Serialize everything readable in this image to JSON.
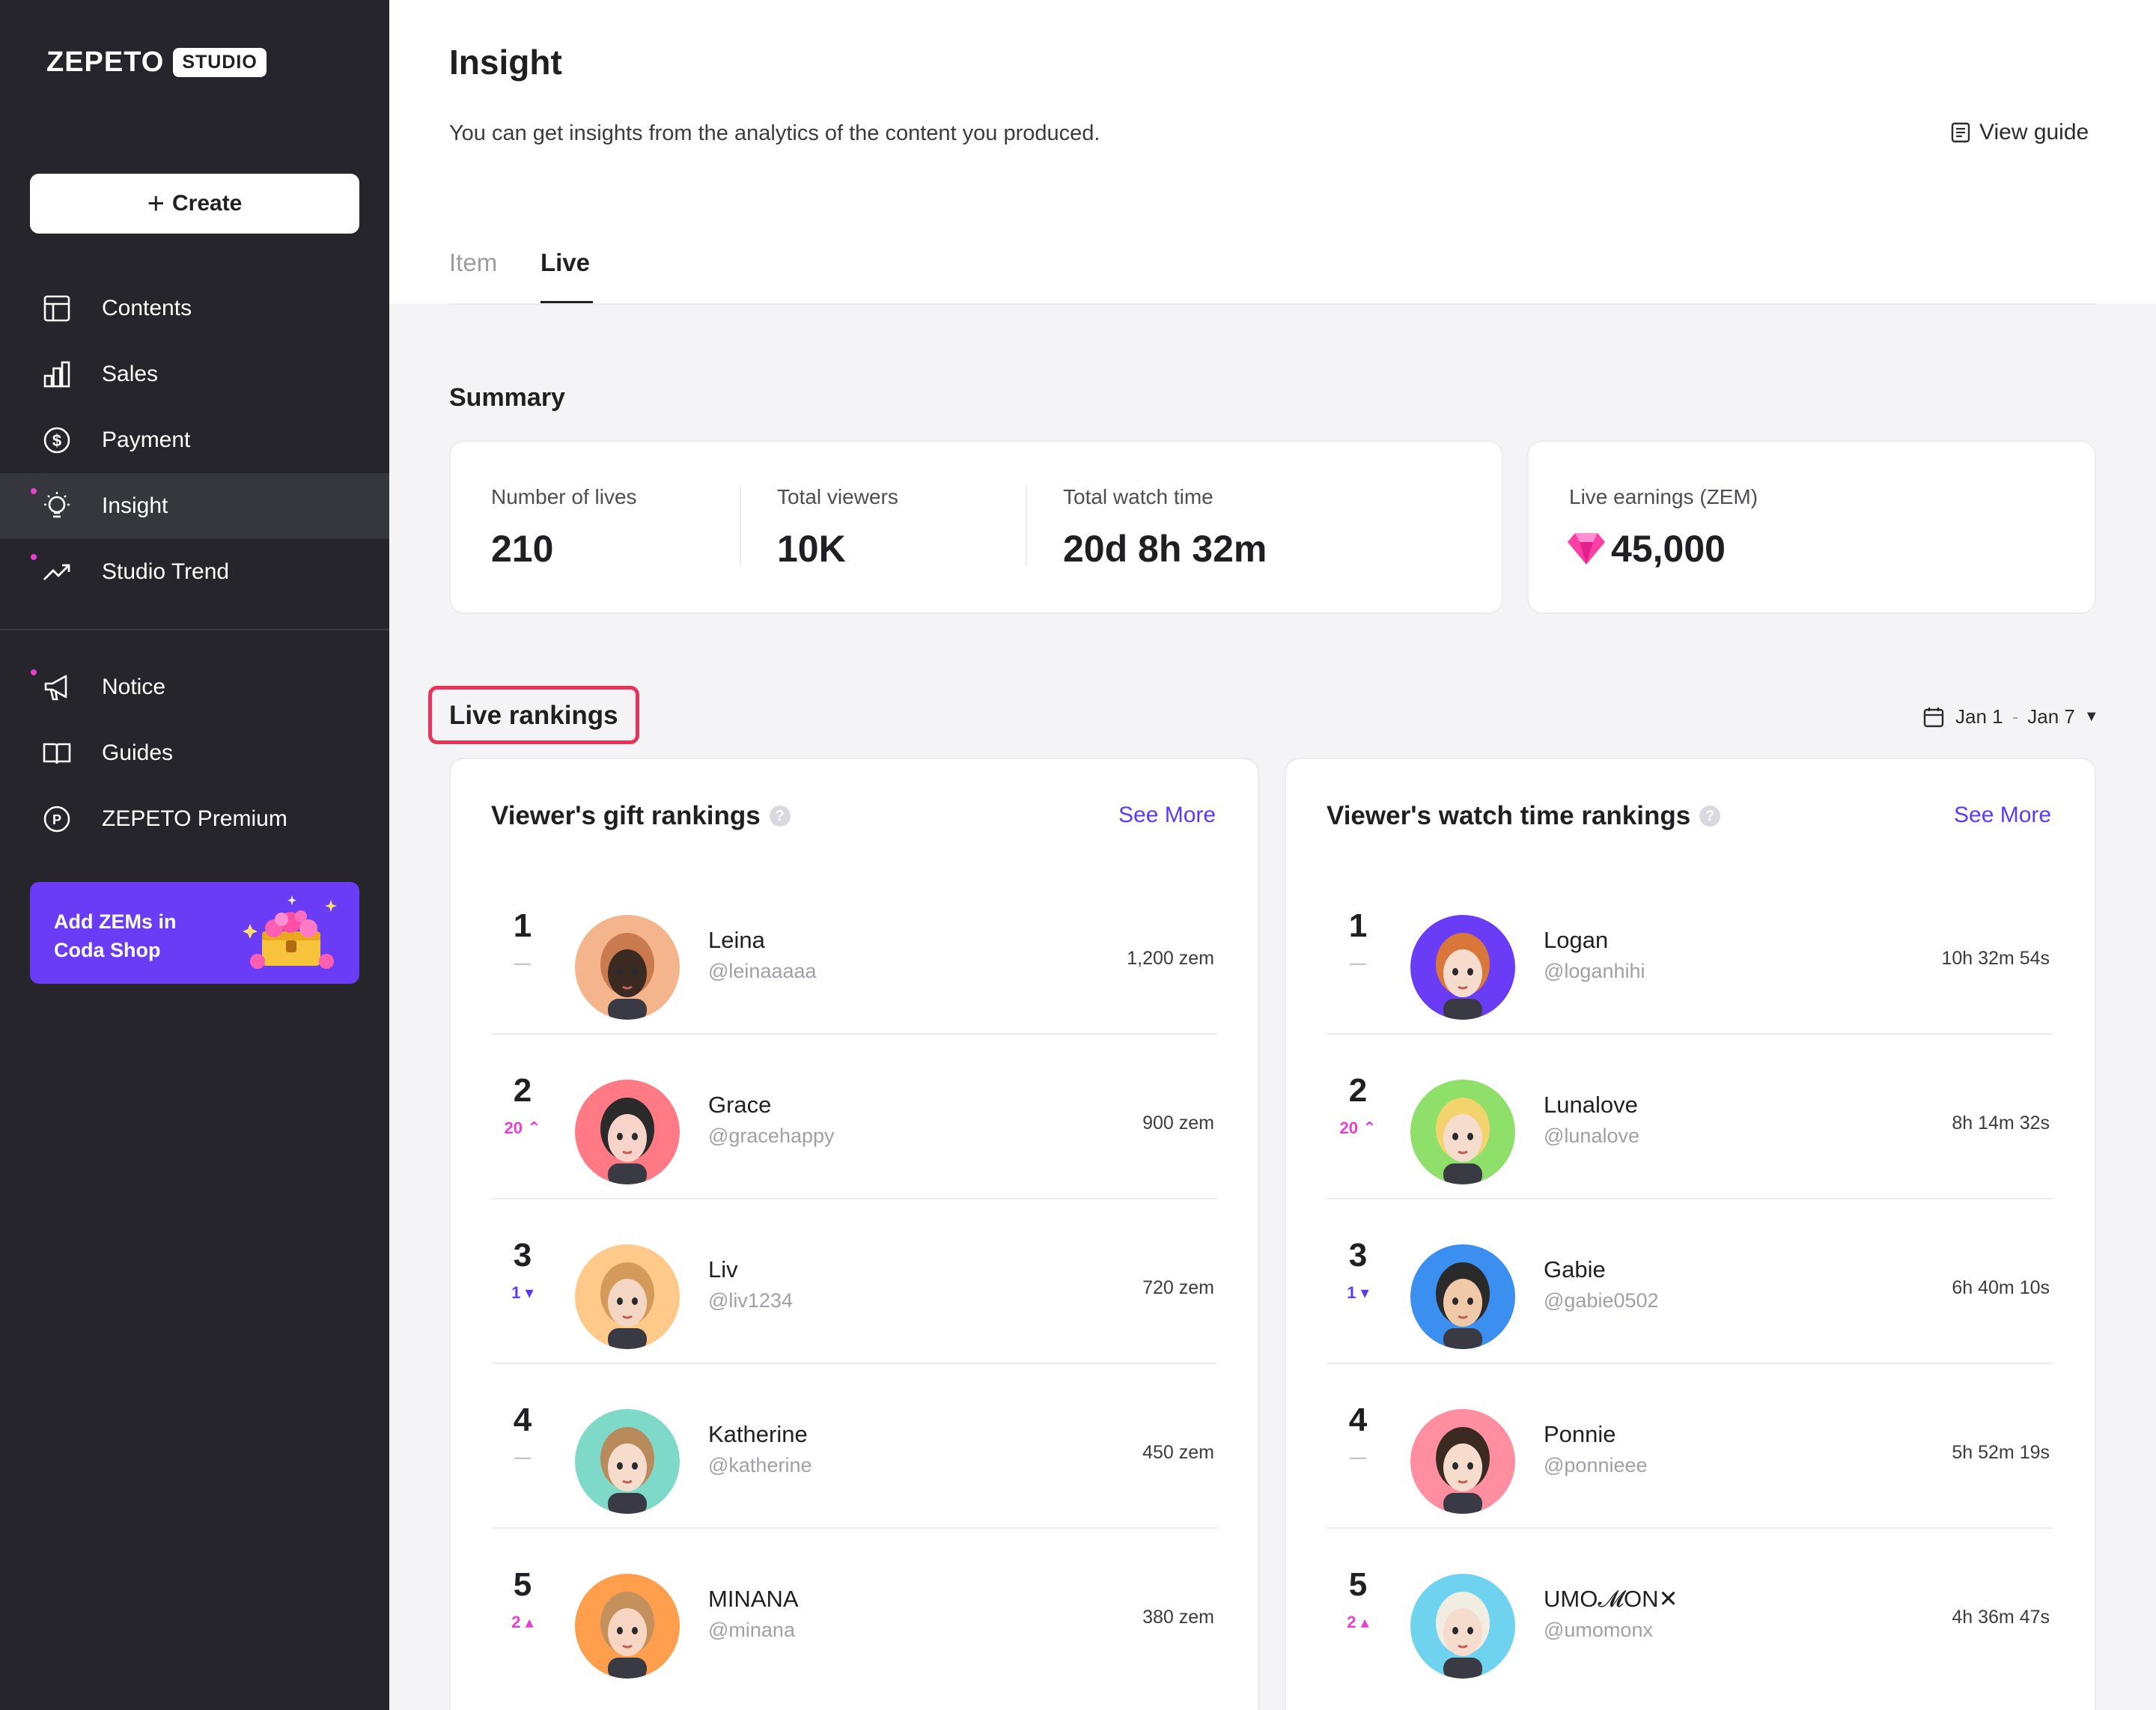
{
  "sidebar": {
    "logo_word": "ZEPETO",
    "logo_badge": "STUDIO",
    "create_label": "Create",
    "items": [
      {
        "label": "Contents",
        "icon": "layout-icon"
      },
      {
        "label": "Sales",
        "icon": "bar-chart-icon"
      },
      {
        "label": "Payment",
        "icon": "dollar-icon"
      },
      {
        "label": "Insight",
        "icon": "lightbulb-icon"
      },
      {
        "label": "Studio Trend",
        "icon": "trend-icon"
      },
      {
        "label": "Notice",
        "icon": "megaphone-icon"
      },
      {
        "label": "Guides",
        "icon": "book-icon"
      },
      {
        "label": "ZEPETO Premium",
        "icon": "premium-icon"
      }
    ],
    "active_item": "Insight",
    "promo_text": "Add ZEMs in\nCoda Shop"
  },
  "header": {
    "title": "Insight",
    "description": "You can get insights from the analytics of the content you produced.",
    "view_guide": "View guide",
    "tabs": [
      {
        "label": "Item"
      },
      {
        "label": "Live"
      }
    ],
    "active_tab": "Live"
  },
  "summary": {
    "title": "Summary",
    "stats": [
      {
        "label": "Number of lives",
        "value": "210"
      },
      {
        "label": "Total viewers",
        "value": "10K"
      },
      {
        "label": "Total watch time",
        "value": "20d 8h 32m"
      }
    ],
    "earnings_label": "Live earnings (ZEM)",
    "earnings_value": "45,000"
  },
  "rankings": {
    "title": "Live rankings",
    "date_start": "Jan 1",
    "date_sep": "-",
    "date_end": "Jan 7",
    "help": "?",
    "gift": {
      "title": "Viewer's gift rankings",
      "see_more": "See More",
      "rows": [
        {
          "rank": "1",
          "change": "—",
          "name": "Leina",
          "handle": "@leinaaaaa",
          "value": "1,200 zem"
        },
        {
          "rank": "2",
          "change": "20 ⌃",
          "name": "Grace",
          "handle": "@gracehappy",
          "value": "900 zem"
        },
        {
          "rank": "3",
          "change": "1 ▾",
          "name": "Liv",
          "handle": "@liv1234",
          "value": "720 zem"
        },
        {
          "rank": "4",
          "change": "—",
          "name": "Katherine",
          "handle": "@katherine",
          "value": "450 zem"
        },
        {
          "rank": "5",
          "change": "2 ▴",
          "name": "MINANA",
          "handle": "@minana",
          "value": "380 zem"
        }
      ]
    },
    "watch": {
      "title": "Viewer's watch time rankings",
      "see_more": "See More",
      "rows": [
        {
          "rank": "1",
          "change": "—",
          "name": "Logan",
          "handle": "@loganhihi",
          "value": "10h 32m 54s"
        },
        {
          "rank": "2",
          "change": "20 ⌃",
          "name": "Lunalove",
          "handle": "@lunalove",
          "value": "8h 14m 32s"
        },
        {
          "rank": "3",
          "change": "1 ▾",
          "name": "Gabie",
          "handle": "@gabie0502",
          "value": "6h 40m 10s"
        },
        {
          "rank": "4",
          "change": "—",
          "name": "Ponnie",
          "handle": "@ponnieee",
          "value": "5h 52m 19s"
        },
        {
          "rank": "5",
          "change": "2 ▴",
          "name": "UMO𝓜ON✕",
          "handle": "@umomonx",
          "value": "4h 36m 47s"
        }
      ]
    }
  },
  "colors": {
    "sidebar_bg": "#25252b",
    "accent_purple": "#5b3cf6",
    "promo_purple": "#6b3cf6",
    "rank_up_pink": "#e63fd1",
    "highlight_red": "#e8345a"
  }
}
